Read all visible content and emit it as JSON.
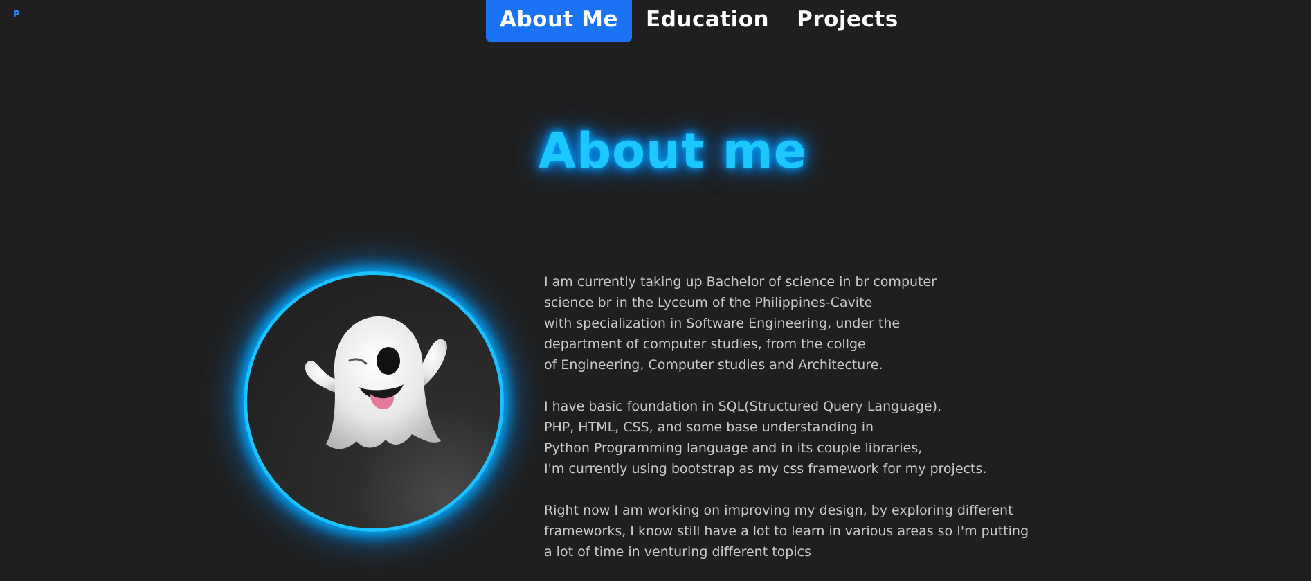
{
  "brand": {
    "label": "P"
  },
  "nav": {
    "items": [
      {
        "label": "About Me",
        "active": true
      },
      {
        "label": "Education",
        "active": false
      },
      {
        "label": "Projects",
        "active": false
      }
    ]
  },
  "colors": {
    "background": "#1f1f1f",
    "accent": "#1cc6ff",
    "nav_active": "#1a73f5",
    "text": "#c9c9c9"
  },
  "hero": {
    "title": "About me",
    "avatar_icon": "ghost-icon"
  },
  "bio": {
    "paragraphs": [
      "I am currently taking up Bachelor of science in br computer\nscience br in the Lyceum of the Philippines-Cavite\nwith specialization in Software Engineering, under the\ndepartment of computer studies, from the collge\nof Engineering, Computer studies and Architecture.",
      "I have basic foundation in SQL(Structured Query Language),\nPHP, HTML, CSS, and some base understanding in\nPython Programming language and in its couple libraries,\nI'm currently using bootstrap as my css framework for my projects.",
      "Right now I am working on improving my design, by exploring different\nframeworks, I know still have a lot to learn in various areas so I'm putting\na lot of time in venturing different topics"
    ]
  }
}
